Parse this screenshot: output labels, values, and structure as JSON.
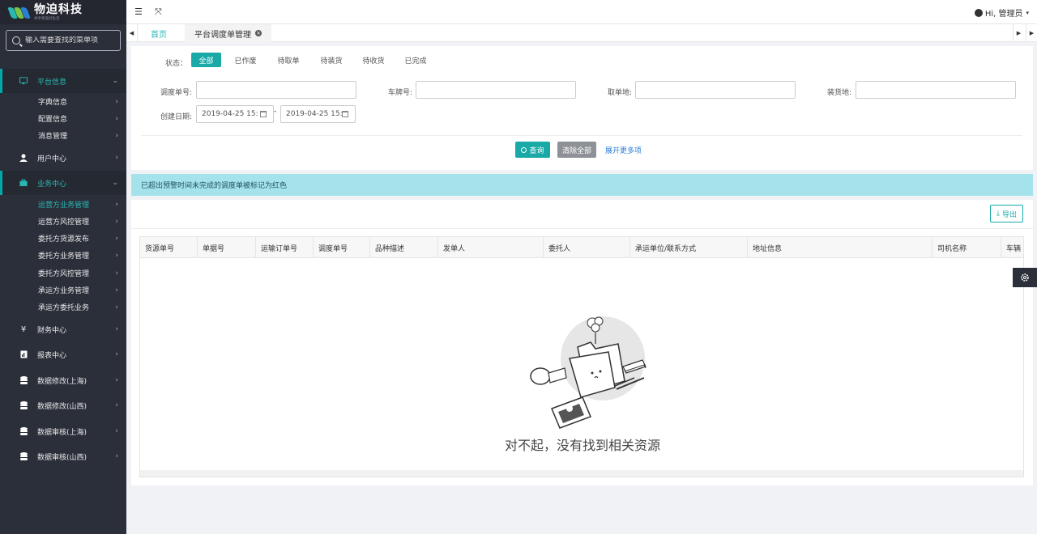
{
  "brand": {
    "title": "物迫科技",
    "subtitle": "共享更美好生活"
  },
  "sidebar": {
    "search_placeholder": "输入需要查找的菜单项",
    "menu": [
      {
        "label": "平台信息",
        "icon": "monitor-icon"
      },
      {
        "label": "用户中心",
        "icon": "user-icon"
      },
      {
        "label": "业务中心",
        "icon": "briefcase-icon"
      },
      {
        "label": "财务中心",
        "icon": "yen-icon"
      },
      {
        "label": "报表中心",
        "icon": "report-icon"
      },
      {
        "label": "数据修改(上海)",
        "icon": "database-icon"
      },
      {
        "label": "数据修改(山西)",
        "icon": "database-icon"
      },
      {
        "label": "数据审核(上海)",
        "icon": "database-icon"
      },
      {
        "label": "数据审核(山西)",
        "icon": "database-icon"
      }
    ],
    "platform_sub": [
      "字典信息",
      "配置信息",
      "消息管理"
    ],
    "business_sub": [
      "运营方业务管理",
      "运营方风控管理",
      "委托方货源发布",
      "委托方业务管理",
      "委托方风控管理",
      "承运方业务管理",
      "承运方委托业务"
    ]
  },
  "topbar": {
    "user_greeting": "Hi, 管理员"
  },
  "tabs": {
    "home": "首页",
    "current": "平台调度单管理"
  },
  "filters": {
    "status_label": "状态：",
    "status_tabs": [
      "全部",
      "已作废",
      "待取单",
      "待装货",
      "待收货",
      "已完成"
    ],
    "dispatch_no_label": "调度单号:",
    "plate_label": "车牌号:",
    "pickup_label": "取单地:",
    "loading_label": "装货地:",
    "created_date_label": "创建日期:",
    "date_from": "2019-04-25 15:",
    "date_to": "2019-04-25 15:",
    "date_separator": "-",
    "query_button": "查询",
    "clear_button": "清除全部",
    "more_link": "展开更多项"
  },
  "alert": {
    "text": "已超出预警时间未完成的调度单被标记为红色"
  },
  "table": {
    "export_button": "导出",
    "columns": [
      "货源单号",
      "单据号",
      "运输订单号",
      "调度单号",
      "品种描述",
      "发单人",
      "委托人",
      "承运单位/联系方式",
      "地址信息",
      "司机名称",
      "车辆"
    ],
    "empty_text": "对不起，没有找到相关资源"
  },
  "colors": {
    "accent": "#19aaa8",
    "sidebar": "#2b2f3a",
    "alert": "#a4e3ec"
  }
}
